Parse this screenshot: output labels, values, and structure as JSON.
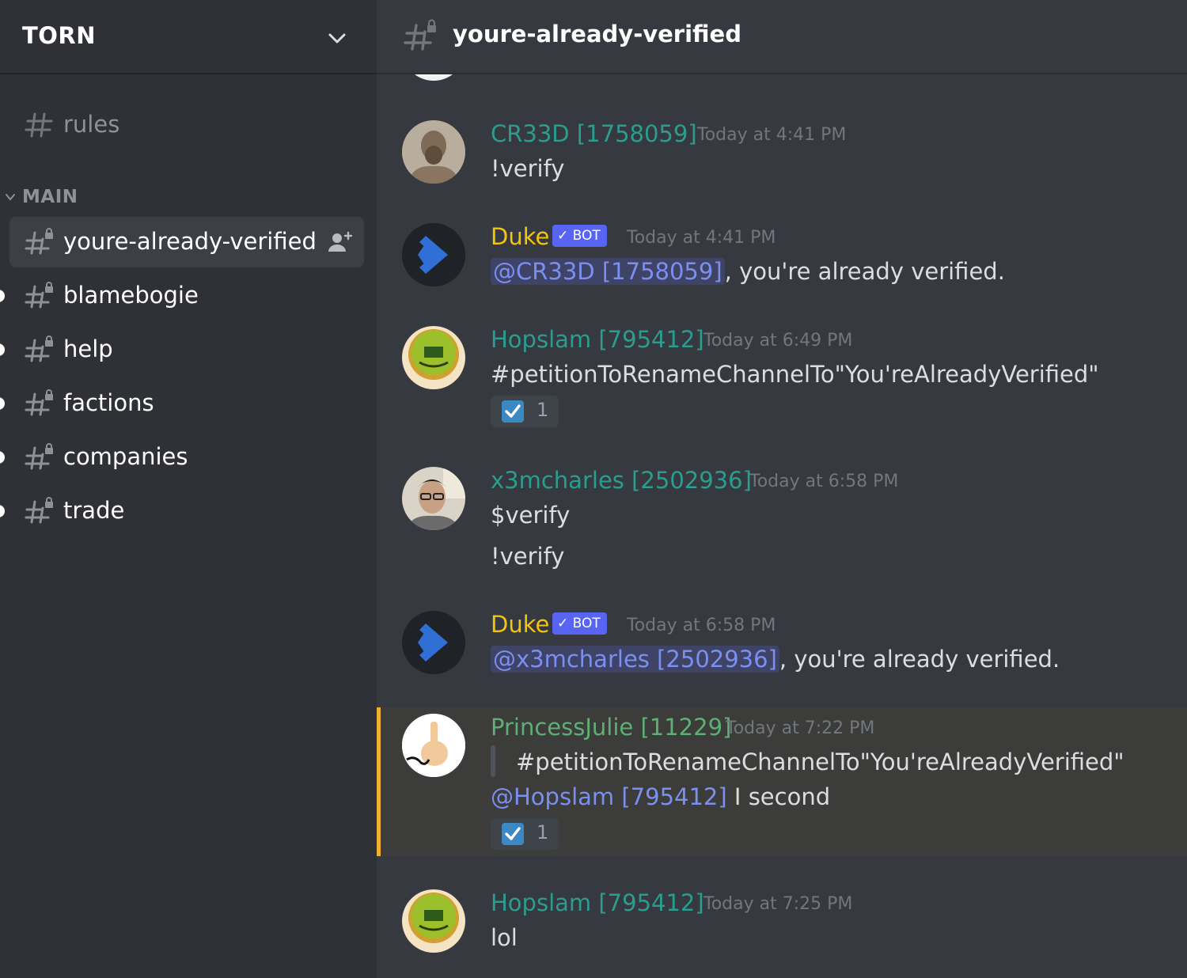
{
  "server": {
    "name": "TORN"
  },
  "channels": {
    "top": [
      {
        "name": "rules"
      }
    ],
    "category": "MAIN",
    "items": [
      {
        "name": "youre-already-verified"
      },
      {
        "name": "blamebogie"
      },
      {
        "name": "help"
      },
      {
        "name": "factions"
      },
      {
        "name": "companies"
      },
      {
        "name": "trade"
      }
    ]
  },
  "header": {
    "channel": "youre-already-verified"
  },
  "bot_badge": "BOT",
  "messages": [
    {
      "author": "CR33D [1758059]",
      "author_color": "#2b9d8f",
      "time": "Today at 4:41 PM",
      "lines": [
        "!verify"
      ]
    },
    {
      "author": "Duke",
      "author_color": "#f1c40f",
      "time": "Today at 4:41 PM",
      "mention": "@CR33D [1758059]",
      "text": ", you're already verified."
    },
    {
      "author": "Hopslam [795412]",
      "author_color": "#2b9d8f",
      "time": "Today at 6:49 PM",
      "lines": [
        "#petitionToRenameChannelTo\"You'reAlreadyVerified\""
      ],
      "reaction_count": "1"
    },
    {
      "author": "x3mcharles [2502936]",
      "author_color": "#2b9d8f",
      "time": "Today at 6:58 PM",
      "lines": [
        "$verify",
        "!verify"
      ]
    },
    {
      "author": "Duke",
      "author_color": "#f1c40f",
      "time": "Today at 6:58 PM",
      "mention": "@x3mcharles [2502936]",
      "text": ", you're already verified."
    },
    {
      "author": "PrincessJulie [11229]",
      "author_color": "#5daf75",
      "time": "Today at 7:22 PM",
      "quote": "#petitionToRenameChannelTo\"You'reAlreadyVerified\"",
      "mention": "@Hopslam [795412]",
      "text": "I second",
      "reaction_count": "1"
    },
    {
      "author": "Hopslam [795412]",
      "author_color": "#2b9d8f",
      "time": "Today at 7:25 PM",
      "lines": [
        "lol"
      ]
    }
  ]
}
